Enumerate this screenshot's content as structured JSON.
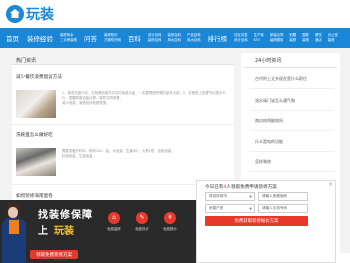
{
  "header": {
    "logo_text": "玩装"
  },
  "nav": {
    "big_items": [
      "首页",
      "装修经验",
      "问答",
      "百科",
      "排行榜"
    ],
    "pairs": [
      [
        "装修风水",
        "二手房装修"
      ],
      [
        "装修知识",
        "方案知识网"
      ],
      [
        "设计百科",
        "装修百科"
      ],
      [
        "装修百科",
        "风水百科"
      ],
      [
        "产品百科",
        "风水百科"
      ],
      [
        "社区问答",
        "设计百科"
      ],
      [
        "生产家",
        "KTV"
      ],
      [
        "家装合同",
        "装修顺序"
      ],
      [
        "别墅",
        "装修"
      ],
      [
        "园林",
        "装修"
      ],
      [
        "餐饮",
        "酒店"
      ],
      [
        "办公室",
        "装修"
      ]
    ]
  },
  "main": {
    "section_title": "热门资讯",
    "articles": [
      {
        "title": "减少餐饮浪费倡议方法",
        "desc": [
          "1、推进光盘行动，在就餐前事先评估好饭菜分量，一定要根据所需的量来点菜；2、在餐桌上放置节约提示卡片，提醒顾客适量点餐，倡导文明用餐，",
          "减少浪费，营造良好就餐氛围。"
        ]
      },
      {
        "title": "洗碗盘怎么做好吃",
        "desc": [
          "需要准备的材料：精肉100，盐、水适量，生姜3片，大葱1根，淀粉适量，",
          "料酒适量，生抽适量。"
        ]
      },
      {
        "title": "如何装修海南蛋卷"
      }
    ],
    "partial_footer_item": "你们是一步做到哦"
  },
  "sidebar": {
    "title": "24小时资讯",
    "items": [
      "古代的上丈夫现在是什么职位",
      "流水阀门该怎么通气和",
      "南瓜炖鸡能炖吗",
      "什么是电的功能",
      "怎样装修",
      "如何用着gnub",
      "黑金装修有什么要点"
    ]
  },
  "promo": {
    "headline_1": "找装修保障",
    "headline_2_prefix": "上",
    "headline_2_highlight": "玩装",
    "features": [
      "免费量房",
      "免费设计",
      "免费报价"
    ],
    "button": "领取免费装修方案"
  },
  "form": {
    "head_prefix": "今日已有",
    "head_count": "4",
    "head_suffix": "人领取免费申请装修方案",
    "city_placeholder": "请选择城市",
    "area_placeholder": "请输入房屋面积",
    "house_type_placeholder": "房屋户型",
    "phone_placeholder": "请输入手机号码",
    "submit": "免费获取装修报价方案",
    "close": "×"
  },
  "colors": {
    "brand_blue": "#1a86d7",
    "accent_red": "#e8382b",
    "highlight_yellow": "#f6c230"
  }
}
